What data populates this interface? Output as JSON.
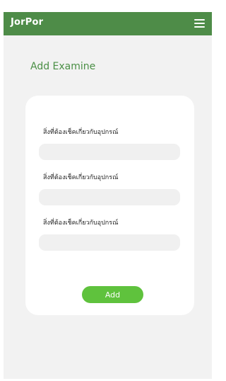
{
  "appbar": {
    "brand": "JorPor",
    "menu_icon": "hamburger-menu-icon"
  },
  "page": {
    "title": "Add Examine"
  },
  "form": {
    "fields": [
      {
        "label": "สิ่งที่ต้องเช็คเกี่ยวกับอุปกรณ์",
        "value": "",
        "placeholder": ""
      },
      {
        "label": "สิ่งที่ต้องเช็คเกี่ยวกับอุปกรณ์",
        "value": "",
        "placeholder": ""
      },
      {
        "label": "สิ่งที่ต้องเช็คเกี่ยวกับอุปกรณ์",
        "value": "",
        "placeholder": ""
      }
    ],
    "submit_label": "Add"
  },
  "colors": {
    "appbar": "#4e8c48",
    "title": "#4a8f45",
    "button": "#5fc23d",
    "background": "#f2f2f2"
  }
}
